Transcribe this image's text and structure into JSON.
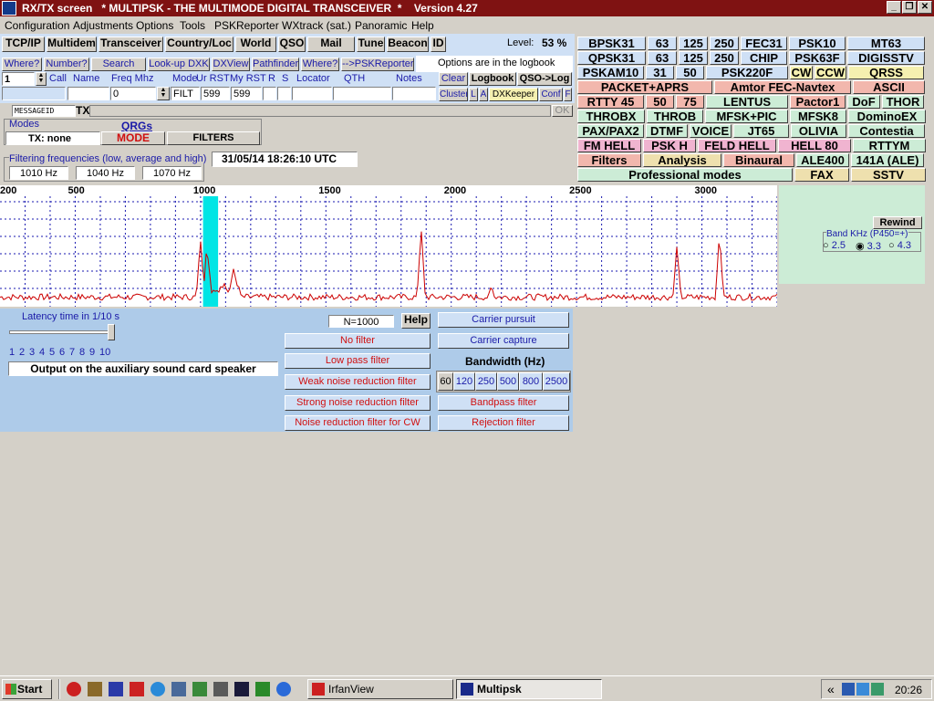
{
  "window": {
    "title": "RX/TX screen   * MULTIPSK - THE MULTIMODE DIGITAL TRANSCEIVER  *    Version 4.27",
    "min": "_",
    "max": "❐",
    "close": "✕"
  },
  "menu": [
    "Configuration",
    "Adjustments",
    "Options",
    "Tools",
    "PSKReporter",
    "WXtrack (sat.)",
    "Panoramic",
    "Help"
  ],
  "toolbar": {
    "buttons": [
      "TCP/IP",
      "Multidem",
      "Transceiver",
      "Country/Loc",
      "World",
      "QSO",
      "Mail",
      "Tune",
      "Beacon",
      "ID"
    ],
    "level_label": "Level:",
    "level_value": "53 %"
  },
  "log": {
    "top_buttons": [
      "Where?",
      "Number?",
      "Search",
      "Look-up DXK",
      "DXView",
      "Pathfinder",
      "Where?",
      "-->PSKReporter"
    ],
    "options_note": "Options are in the logbook",
    "spin_value": "1",
    "headers": [
      "Call",
      "Name",
      "Freq Mhz",
      "Mode",
      "Ur RST",
      "My RST",
      "R",
      "S",
      "Locator",
      "QTH",
      "Notes"
    ],
    "freq_value": "0",
    "mode_value": "FILT",
    "ur_rst": "599",
    "my_rst": "599",
    "right_buttons_1": [
      "Clear",
      "Logbook",
      "QSO->Log"
    ],
    "right_buttons_2": [
      "Cluster",
      "L",
      "A",
      "DXKeeper",
      "Conf",
      "F"
    ]
  },
  "message": {
    "id": "MESSAGEID",
    "tx": "TX",
    "ok": "OK"
  },
  "modes_panel": {
    "label": "Modes",
    "qrgs": "QRGs",
    "tx_label": "TX: none",
    "mode_button": "MODE",
    "filters_button": "FILTERS"
  },
  "filtering": {
    "label": "Filtering frequencies (low, average and high)",
    "low": "1010 Hz",
    "avg": "1040 Hz",
    "high": "1070 Hz",
    "datetime": "31/05/14 18:26:10 UTC"
  },
  "modes": [
    [
      {
        "t": "BPSK31",
        "c": ""
      },
      {
        "t": "63",
        "c": ""
      },
      {
        "t": "125",
        "c": ""
      },
      {
        "t": "250",
        "c": ""
      },
      {
        "t": "FEC31",
        "c": ""
      },
      {
        "t": "PSK10",
        "c": ""
      },
      {
        "t": "MT63",
        "c": ""
      }
    ],
    [
      {
        "t": "QPSK31",
        "c": ""
      },
      {
        "t": "63",
        "c": ""
      },
      {
        "t": "125",
        "c": ""
      },
      {
        "t": "250",
        "c": ""
      },
      {
        "t": "CHIP",
        "c": ""
      },
      {
        "t": "PSK63F",
        "c": ""
      },
      {
        "t": "DIGISSTV",
        "c": ""
      }
    ],
    [
      {
        "t": "PSKAM10",
        "c": ""
      },
      {
        "t": "31",
        "c": ""
      },
      {
        "t": "50",
        "c": ""
      },
      {
        "t": "PSK220F",
        "c": ""
      },
      {
        "t": "CW",
        "c": "yellow"
      },
      {
        "t": "CCW",
        "c": "yellow"
      },
      {
        "t": "QRSS",
        "c": "yellow"
      }
    ],
    [
      {
        "t": "PACKET+APRS",
        "c": "salmon"
      },
      {
        "t": "Amtor FEC-Navtex",
        "c": "salmon"
      },
      {
        "t": "ASCII",
        "c": "salmon"
      }
    ],
    [
      {
        "t": "RTTY 45",
        "c": "salmon"
      },
      {
        "t": "50",
        "c": "salmon"
      },
      {
        "t": "75",
        "c": "salmon"
      },
      {
        "t": "LENTUS",
        "c": "mint"
      },
      {
        "t": "Pactor1",
        "c": "salmon"
      },
      {
        "t": "DoF",
        "c": "mint"
      },
      {
        "t": "THOR",
        "c": "mint"
      }
    ],
    [
      {
        "t": "THROBX",
        "c": "mint"
      },
      {
        "t": "THROB",
        "c": "mint"
      },
      {
        "t": "MFSK+PIC",
        "c": "mint"
      },
      {
        "t": "MFSK8",
        "c": "mint"
      },
      {
        "t": "DominoEX",
        "c": "mint"
      }
    ],
    [
      {
        "t": "PAX/PAX2",
        "c": "mint"
      },
      {
        "t": "DTMF",
        "c": "mint"
      },
      {
        "t": "VOICE",
        "c": "mint"
      },
      {
        "t": "JT65",
        "c": "mint"
      },
      {
        "t": "OLIVIA",
        "c": "mint"
      },
      {
        "t": "Contestia",
        "c": "mint"
      }
    ],
    [
      {
        "t": "FM HELL",
        "c": "pink"
      },
      {
        "t": "PSK H",
        "c": "pink"
      },
      {
        "t": "FELD HELL",
        "c": "pink"
      },
      {
        "t": "HELL 80",
        "c": "pink"
      },
      {
        "t": "RTTYM",
        "c": "mint"
      }
    ],
    [
      {
        "t": "Filters",
        "c": "salmon"
      },
      {
        "t": "Analysis",
        "c": "tan"
      },
      {
        "t": "Binaural",
        "c": "salmon"
      },
      {
        "t": "ALE400",
        "c": "mint"
      },
      {
        "t": "141A (ALE)",
        "c": "mint"
      }
    ],
    [
      {
        "t": "Professional modes",
        "c": "mint"
      },
      {
        "t": "FAX",
        "c": "tan"
      },
      {
        "t": "SSTV",
        "c": "tan"
      }
    ]
  ],
  "spectrum": {
    "ticks": [
      "200",
      "500",
      "1000",
      "1500",
      "2000",
      "2500",
      "3000"
    ],
    "rewind": "Rewind",
    "band_label": "Band KHz (P450=+)",
    "band_options": [
      "2.5",
      "3.3",
      "4.3"
    ],
    "band_selected": "3.3"
  },
  "latency": {
    "label": "Latency time in 1/10 s",
    "scale": [
      "1",
      "2",
      "3",
      "4",
      "5",
      "6",
      "7",
      "8",
      "9",
      "10"
    ],
    "output": "Output on the auxiliary sound card speaker"
  },
  "filters": {
    "n_value": "N=1000",
    "help": "Help",
    "left": [
      "No filter",
      "Low pass filter",
      "Weak noise reduction filter",
      "Strong noise reduction filter",
      "Noise reduction filter for CW"
    ],
    "carrier_pursuit": "Carrier pursuit",
    "carrier_capture": "Carrier capture",
    "bandwidth_label": "Bandwidth (Hz)",
    "bandwidths": [
      "60",
      "120",
      "250",
      "500",
      "800",
      "2500"
    ],
    "bandpass": "Bandpass filter",
    "rejection": "Rejection filter"
  },
  "taskbar": {
    "start": "Start",
    "tasks": [
      "IrfanView",
      "Multipsk"
    ],
    "tray_prefix": "«",
    "clock": "20:26"
  },
  "colors": {
    "titlebar": "#7f1212",
    "panel_blue": "#aecbe9",
    "spectrum_line": "#cc0000",
    "spectrum_grid": "#1a1ab0",
    "cursor": "#00e5e5"
  }
}
